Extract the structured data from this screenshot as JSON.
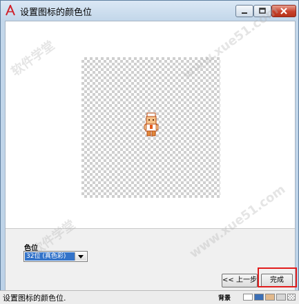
{
  "window": {
    "title": "设置图标的颜色位",
    "buttons": {
      "minimize": "minimize",
      "maximize": "maximize",
      "close": "close"
    }
  },
  "preview": {
    "background": "transparent-checkerboard",
    "sprite_icon": "pixel-character-icon"
  },
  "color_depth": {
    "label": "色位",
    "selected": "32位 (真色彩)"
  },
  "buttons": {
    "prev_label": "<< 上一步",
    "finish_label": "完成"
  },
  "status_bar": {
    "text": "设置图标的颜色位.",
    "background_label": "背景",
    "swatches": [
      "#ffffff",
      "#3b6fb6",
      "#e2b98c",
      "#d6d6d6",
      "checkerboard"
    ]
  },
  "watermark": {
    "text": "软件学堂",
    "site": "www.xue51.com"
  },
  "colors": {
    "accent_select": "#3373c9",
    "highlight": "#e11b1b",
    "close_button": "#c7412c"
  }
}
